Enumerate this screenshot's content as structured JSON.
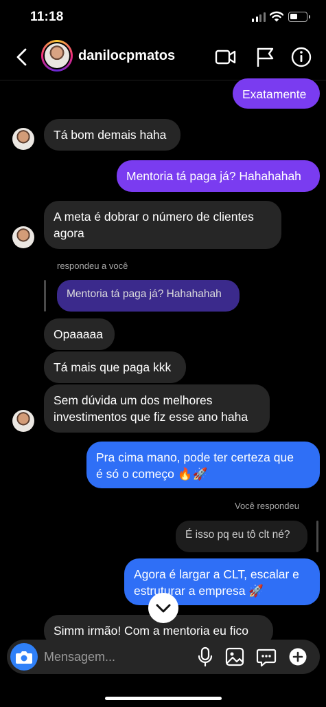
{
  "status_bar": {
    "time": "11:18"
  },
  "header": {
    "username": "danilocpmatos"
  },
  "messages": {
    "m1": "Exatamente",
    "m2": "Tá bom demais haha",
    "m3": "Mentoria tá paga já? Hahahahah",
    "m4": "A meta é dobrar o número de clientes\nagora",
    "reply_note_1": "respondeu a você",
    "quoted_1": "Mentoria tá paga já? Hahahahah",
    "m5": "Opaaaaa",
    "m6": "Tá mais que paga kkk",
    "m7": "Sem dúvida um dos melhores\ninvestimentos que fiz esse ano haha",
    "m8": "Pra cima mano, pode ter certeza que\né só o começo 🔥🚀",
    "reply_note_2": "Você respondeu",
    "quoted_2": "É isso pq eu tô clt né?",
    "m9": "Agora é largar a CLT, escalar e\nestruturar a empresa 🚀",
    "m10": "Simm irmão! Com a mentoria eu fico"
  },
  "composer": {
    "placeholder": "Mensagem..."
  },
  "colors": {
    "purple": "#7a3cf0",
    "blue": "#2f6ff6",
    "incoming": "#262626"
  }
}
